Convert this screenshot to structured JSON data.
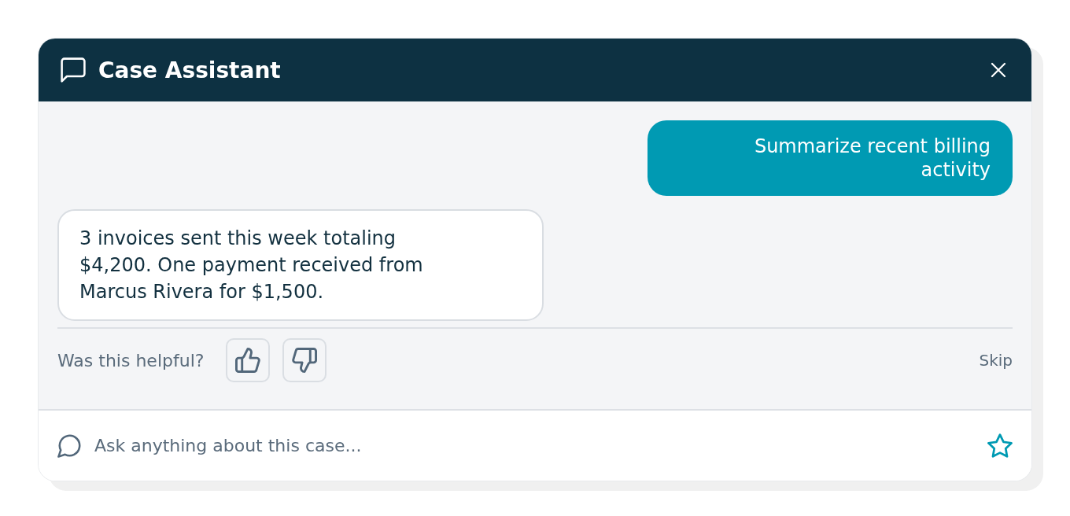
{
  "header": {
    "title": "Case Assistant"
  },
  "messages": [
    {
      "kind": "user",
      "text": "Summarize recent billing activity"
    },
    {
      "kind": "assistant",
      "text": "3 invoices sent this week totaling $4,200. One payment received from Marcus Rivera for $1,500."
    }
  ],
  "feedback": {
    "prompt": "Was this helpful?",
    "ratings": [
      {
        "kind": "thumbs_up",
        "selected": false
      },
      {
        "kind": "thumbs_down",
        "selected": false
      }
    ],
    "skip": "Skip"
  },
  "composer": {
    "placeholder": "Ask anything about this case..."
  }
}
